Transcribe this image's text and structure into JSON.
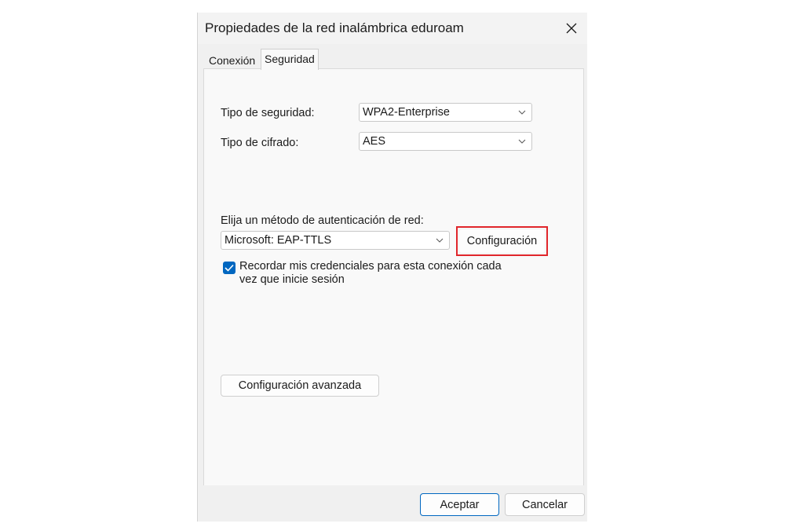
{
  "dialog": {
    "title": "Propiedades de la red inalámbrica eduroam",
    "close_icon": "close-icon"
  },
  "tabs": [
    {
      "label": "Conexión",
      "active": false
    },
    {
      "label": "Seguridad",
      "active": true
    }
  ],
  "security": {
    "security_type_label": "Tipo de seguridad:",
    "security_type_value": "WPA2-Enterprise",
    "encryption_type_label": "Tipo de cifrado:",
    "encryption_type_value": "AES",
    "auth_method_label": "Elija un método de autenticación de red:",
    "auth_method_value": "Microsoft: EAP-TTLS",
    "settings_button": "Configuración",
    "remember_credentials_label": "Recordar mis credenciales para esta conexión cada vez que inicie sesión",
    "remember_credentials_checked": true,
    "advanced_settings_button": "Configuración avanzada"
  },
  "footer": {
    "ok_button": "Aceptar",
    "cancel_button": "Cancelar"
  },
  "colors": {
    "accent": "#0067c0",
    "highlight_border": "#e0262b"
  }
}
